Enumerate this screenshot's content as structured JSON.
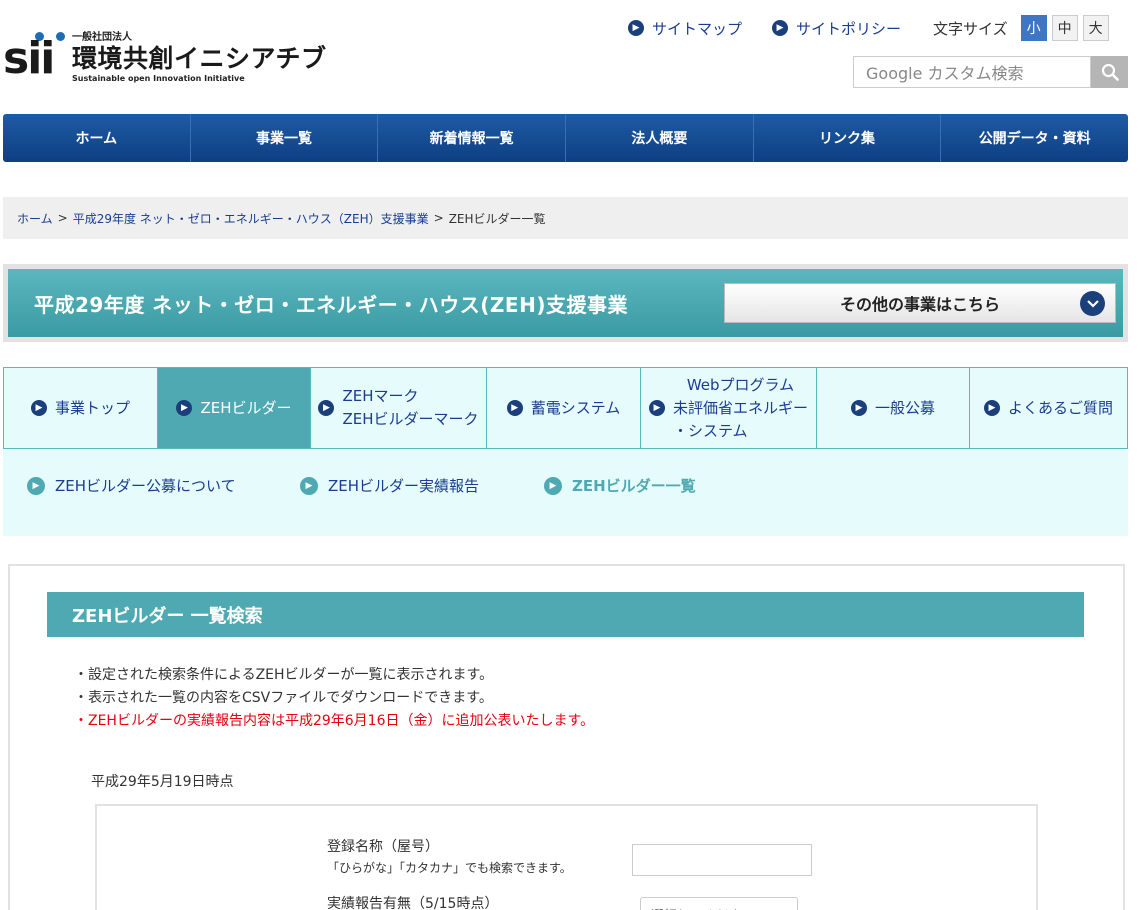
{
  "header": {
    "logo_mark": "sii",
    "org_type": "一般社団法人",
    "org_name": "環境共創イニシアチブ",
    "org_name_en": "Sustainable open Innovation Initiative",
    "links": [
      {
        "label": "サイトマップ"
      },
      {
        "label": "サイトポリシー"
      }
    ],
    "font_size": {
      "label": "文字サイズ",
      "options": [
        "小",
        "中",
        "大"
      ],
      "selected": "小"
    },
    "search": {
      "placeholder": "Google カスタム検索",
      "button_icon": "search-icon"
    }
  },
  "global_nav": [
    "ホーム",
    "事業一覧",
    "新着情報一覧",
    "法人概要",
    "リンク集",
    "公開データ・資料"
  ],
  "breadcrumb": {
    "items": [
      "ホーム",
      "平成29年度 ネット・ゼロ・エネルギー・ハウス（ZEH）支援事業"
    ],
    "current": "ZEHビルダー一覧",
    "separator": ">"
  },
  "banner": {
    "title": "平成29年度 ネット・ゼロ・エネルギー・ハウス(ZEH)支援事業",
    "other_projects": "その他の事業はこちら"
  },
  "sub_nav": [
    {
      "line1": "事業トップ",
      "line2": "",
      "line3": ""
    },
    {
      "line1": "ZEHビルダー",
      "line2": "",
      "line3": ""
    },
    {
      "line1": "ZEHマーク",
      "line2": "ZEHビルダーマーク",
      "line3": ""
    },
    {
      "line1": "蓄電システム",
      "line2": "",
      "line3": ""
    },
    {
      "line1": "Webプログラム",
      "line2": "未評価省エネルギー",
      "line3": "・システム"
    },
    {
      "line1": "一般公募",
      "line2": "",
      "line3": ""
    },
    {
      "line1": "よくあるご質問",
      "line2": "",
      "line3": ""
    }
  ],
  "sub_sub_nav": [
    "ZEHビルダー公募について",
    "ZEHビルダー実績報告",
    "ZEHビルダー一覧"
  ],
  "main": {
    "section_title": "ZEHビルダー 一覧検索",
    "notes": [
      "・設定された検索条件によるZEHビルダーが一覧に表示されます。",
      "・表示された一覧の内容をCSVファイルでダウンロードできます。"
    ],
    "notice_red": "・ZEHビルダーの実績報告内容は平成29年6月16日（金）に追加公表いたします。",
    "as_of": "平成29年5月19日時点",
    "form": {
      "name_label": "登録名称（屋号）",
      "name_hint": "「ひらがな」「カタカナ」でも検索できます。",
      "name_value": "",
      "report_label": "実績報告有無（5/15時点）",
      "report_select": "選択してください"
    }
  },
  "colors": {
    "nav_blue": "#1f5ba5",
    "teal": "#4fa9b2",
    "tab_bg": "#e6fbfc",
    "notice_red": "#e60012",
    "link_blue": "#1a3d8f"
  }
}
